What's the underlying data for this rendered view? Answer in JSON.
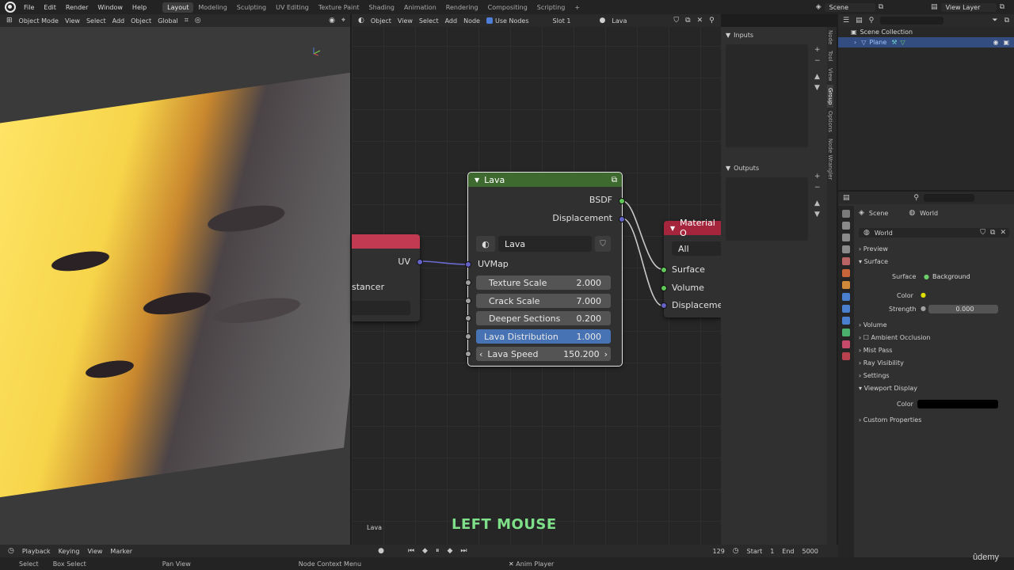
{
  "topbar": {
    "menus": [
      "File",
      "Edit",
      "Render",
      "Window",
      "Help"
    ],
    "workspaces": [
      "Layout",
      "Modeling",
      "Sculpting",
      "UV Editing",
      "Texture Paint",
      "Shading",
      "Animation",
      "Rendering",
      "Compositing",
      "Scripting"
    ],
    "active_workspace": "Layout",
    "scene": "Scene",
    "view_layer": "View Layer"
  },
  "viewport": {
    "mode": "Object Mode",
    "menus": [
      "View",
      "Select",
      "Add",
      "Object"
    ],
    "orientation": "Global"
  },
  "node_editor": {
    "type": "Object",
    "menus": [
      "View",
      "Select",
      "Add",
      "Node"
    ],
    "use_nodes": "Use Nodes",
    "slot": "Slot 1",
    "material": "Lava",
    "footer_label": "Lava",
    "nodes": {
      "left": {
        "uv_label": "UV",
        "partial_text": "stancer"
      },
      "lava": {
        "title": "Lava",
        "out_bsdf": "BSDF",
        "out_displacement": "Displacement",
        "group_name": "Lava",
        "in_uvmap": "UVMap",
        "fields": [
          {
            "label": "Texture Scale",
            "value": "2.000"
          },
          {
            "label": "Crack Scale",
            "value": "7.000"
          },
          {
            "label": "Deeper Sections",
            "value": "0.200"
          },
          {
            "label": "Lava Distribution",
            "value": "1.000"
          },
          {
            "label": "Lava Speed",
            "value": "150.200"
          }
        ]
      },
      "material_output": {
        "title": "Material O",
        "target": "All",
        "in_surface": "Surface",
        "in_volume": "Volume",
        "in_displacement": "Displaceme"
      }
    }
  },
  "group_panel": {
    "inputs": "Inputs",
    "outputs": "Outputs",
    "tabs": [
      "Node",
      "Tool",
      "View",
      "Group",
      "Options",
      "Node Wrangler"
    ]
  },
  "outliner": {
    "root": "Scene Collection",
    "item": "Plane"
  },
  "properties": {
    "scene": "Scene",
    "world": "World",
    "world_name": "World",
    "sections": {
      "preview": "Preview",
      "surface": "Surface",
      "surface_label": "Surface",
      "surface_value": "Background",
      "color_label": "Color",
      "strength_label": "Strength",
      "strength_value": "0.000",
      "volume": "Volume",
      "ambient_occlusion": "Ambient Occlusion",
      "mist_pass": "Mist Pass",
      "ray_visibility": "Ray Visibility",
      "settings": "Settings",
      "viewport_display": "Viewport Display",
      "vd_color_label": "Color",
      "custom_properties": "Custom Properties"
    }
  },
  "timeline": {
    "menus": [
      "Playback",
      "Keying",
      "View",
      "Marker"
    ],
    "frame": "129",
    "start_label": "Start",
    "start_value": "1",
    "end_label": "End",
    "end_value": "5000"
  },
  "statusbar": {
    "select": "Select",
    "box_select": "Box Select",
    "pan_view": "Pan View",
    "context_menu": "Node Context Menu",
    "anim_player": "Anim Player"
  },
  "caption": "LEFT MOUSE",
  "watermark": "ûdemy"
}
